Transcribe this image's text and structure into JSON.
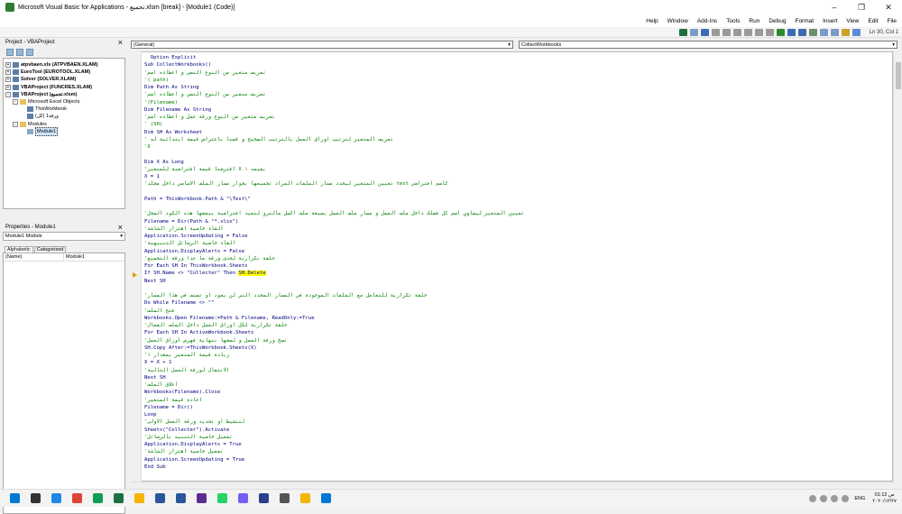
{
  "window": {
    "title": "Microsoft Visual Basic for Applications - تجميع.xlsm [break] - [Module1 (Code)]",
    "controls": [
      "–",
      "❐",
      "✕"
    ]
  },
  "menu": [
    "File",
    "Edit",
    "View",
    "Insert",
    "Format",
    "Debug",
    "Run",
    "Tools",
    "Add-Ins",
    "Window",
    "Help"
  ],
  "toolbar": {
    "position": "Ln 30, Col 1"
  },
  "project": {
    "title": "Project - VBAProject",
    "tree": [
      {
        "label": "atpvbaen.xls (ATPVBAEN.XLAM)",
        "bold": true,
        "toggle": "+",
        "indent": 0
      },
      {
        "label": "EuroTool (EUROTOOL.XLAM)",
        "bold": true,
        "toggle": "+",
        "indent": 0
      },
      {
        "label": "Solver (SOLVER.XLAM)",
        "bold": true,
        "toggle": "+",
        "indent": 0
      },
      {
        "label": "VBAProject (FUNCRES.XLAM)",
        "bold": true,
        "toggle": "+",
        "indent": 0
      },
      {
        "label": "VBAProject (تجميع.xlsm)",
        "bold": true,
        "toggle": "-",
        "indent": 0
      },
      {
        "label": "Microsoft Excel Objects",
        "bold": false,
        "toggle": "-",
        "indent": 1,
        "icon": "folder"
      },
      {
        "label": "ThisWorkbook",
        "bold": false,
        "toggle": "",
        "indent": 2,
        "icon": "sheet"
      },
      {
        "label": "(كل) ورقة1",
        "bold": false,
        "toggle": "",
        "indent": 2,
        "icon": "sheet"
      },
      {
        "label": "Modules",
        "bold": false,
        "toggle": "-",
        "indent": 1,
        "icon": "folder"
      },
      {
        "label": "Module1",
        "bold": false,
        "toggle": "",
        "indent": 2,
        "icon": "module",
        "selected": true
      }
    ]
  },
  "properties": {
    "title": "Properties - Module1",
    "object": "Module1 Module",
    "tabs": [
      "Alphabetic",
      "Categorized"
    ],
    "rows": [
      {
        "name": "(Name)",
        "value": "Module1"
      }
    ]
  },
  "code": {
    "object_combo": "(General)",
    "proc_combo": "CollectWorkbooks",
    "lines": [
      {
        "t": "  Option Explicit",
        "c": false
      },
      {
        "t": "Sub CollectWorkbooks()",
        "c": false
      },
      {
        "t": "تعريف متغير من النوع النصي و اعطاءه اسم'",
        "c": true,
        "ar": true
      },
      {
        "t": "'( path)",
        "c": true
      },
      {
        "t": "Dim Path As String",
        "c": false
      },
      {
        "t": "تعريف متغير من النوع النصي و اعطاءه اسم'",
        "c": true,
        "ar": true
      },
      {
        "t": "'(Filename)",
        "c": true
      },
      {
        "t": "Dim Filename As String",
        "c": false
      },
      {
        "t": "تعريف متغير من النوع ورقة عمل و اعطاءه اسم'",
        "c": true,
        "ar": true
      },
      {
        "t": "' (SH)",
        "c": true
      },
      {
        "t": "Dim SH As Worksheet",
        "c": false
      },
      {
        "t": "تعريف المتغير لترتيب اوراق العمل بالترتيب الصحيح و قمنا باعتراض قيمة ابتدائية له '",
        "c": true,
        "ar": true
      },
      {
        "t": "'X",
        "c": true
      },
      {
        "t": "",
        "c": false
      },
      {
        "t": "Dim X As Long",
        "c": false
      },
      {
        "t": "بقيمه ١ X افترضنا قيمة افتراضية للمتغير'",
        "c": true,
        "ar": true
      },
      {
        "t": "X = 1",
        "c": false
      },
      {
        "t": "كاسم افتراضي test تعيين المتغير ليحدد مسار الملفات المراد تجميعها بجوار مسار الملف الاساسي داخل مجلد'",
        "c": true,
        "ar": true
      },
      {
        "t": "",
        "c": false
      },
      {
        "t": "Path = ThisWorkbook.Path & \"\\Test\\\"",
        "c": false
      },
      {
        "t": "",
        "c": false
      },
      {
        "t": "تعيين المتغير ليساوي اسم كل فصلك داخل ملف العمل و مسار ملف العمل بصيغة ملف اكسل مالترو لتعيد افتراضية ببعضها هذه الكود المحل'",
        "c": true,
        "ar": true
      },
      {
        "t": "Filename = Dir(Path & \"*.xlsx\")",
        "c": false
      },
      {
        "t": "القاء خاصية اهتزاز الشاشة'",
        "c": true,
        "ar": true
      },
      {
        "t": "Application.ScreenUpdating = False",
        "c": false
      },
      {
        "t": "القاء خاصية الرسائل التنبيهية'",
        "c": true,
        "ar": true
      },
      {
        "t": "Application.DisplayAlerts = False",
        "c": false
      },
      {
        "t": "حلقة تكرارية لحذف ورقة ما عدا ورقة التجميع'",
        "c": true,
        "ar": true
      },
      {
        "t": "For Each SH In ThisWorkbook.Sheets",
        "c": false
      },
      {
        "t": "If SH.Name <> \"Collecter\" Then ",
        "c": false,
        "hl": "SH.Delete"
      },
      {
        "t": "Next SH",
        "c": false
      },
      {
        "t": "",
        "c": false
      },
      {
        "t": "حلقة تكرارية للتعامل مع الملفات الموجودة في المسار المحدد التي لن يعود او تصنف في هذا المسار'",
        "c": true,
        "ar": true
      },
      {
        "t": "Do While Filename <> \"\"",
        "c": false
      },
      {
        "t": "فتح الملف'",
        "c": true,
        "ar": true
      },
      {
        "t": "Workbooks.Open Filename:=Path & Filename, ReadOnly:=True",
        "c": false
      },
      {
        "t": "حلقة تكرارية لكل اوراق العمل داخل الملف الفعال'",
        "c": true,
        "ar": true
      },
      {
        "t": "For Each SH In ActiveWorkbook.Sheets",
        "c": false
      },
      {
        "t": "نسخ ورقة العمل و لصقها بنهاية فهرس اوراق العمل'",
        "c": true,
        "ar": true
      },
      {
        "t": "SH.Copy After:=ThisWorkbook.Sheets(X)",
        "c": false
      },
      {
        "t": "زيادة قيمة المتغير بمقدار ١'",
        "c": true,
        "ar": true
      },
      {
        "t": "X = X + 1",
        "c": false
      },
      {
        "t": "الانتقال لورقة العمل التالية'",
        "c": true,
        "ar": true
      },
      {
        "t": "Next SH",
        "c": false
      },
      {
        "t": "اغلاق الملف'",
        "c": true,
        "ar": true
      },
      {
        "t": "Workbooks(Filename).Close",
        "c": false
      },
      {
        "t": "اعادة قيمة المتغير'",
        "c": true,
        "ar": true
      },
      {
        "t": "Filename = Dir()",
        "c": false
      },
      {
        "t": "Loop",
        "c": false
      },
      {
        "t": "لتنشيط او تحديد ورقة العمل الاولى'",
        "c": true,
        "ar": true
      },
      {
        "t": "Sheets(\"Collecter\").Activate",
        "c": false
      },
      {
        "t": "تفعيل خاصية التنبيه بالرسائل'",
        "c": true,
        "ar": true
      },
      {
        "t": "Application.DisplayAlerts = True",
        "c": false
      },
      {
        "t": "تفعيل خاصية اهتزاز الشاشة'",
        "c": true,
        "ar": true
      },
      {
        "t": "Application.ScreenUpdating = True",
        "c": false
      },
      {
        "t": "End Sub",
        "c": false
      }
    ]
  },
  "taskbar": {
    "language": "ENG",
    "time": "01:12 ص",
    "date": "٢٠٢٠/١٢/٢٧",
    "apps": [
      {
        "icon": "windows-icon",
        "color": "#0078d4"
      },
      {
        "icon": "search-icon",
        "color": "#333333"
      },
      {
        "icon": "edge-icon",
        "color": "#1e88e5"
      },
      {
        "icon": "chrome-icon",
        "color": "#db4437"
      },
      {
        "icon": "edge-new-icon",
        "color": "#0f9d58"
      },
      {
        "icon": "excel-icon",
        "color": "#1d6f42"
      },
      {
        "icon": "chrome-2-icon",
        "color": "#f4b400"
      },
      {
        "icon": "folder-icon",
        "color": "#2b579a"
      },
      {
        "icon": "word-icon",
        "color": "#2b579a"
      },
      {
        "icon": "teams-icon",
        "color": "#5c2d91"
      },
      {
        "icon": "whatsapp-icon",
        "color": "#25d366"
      },
      {
        "icon": "viber-icon",
        "color": "#7360f2"
      },
      {
        "icon": "premiere-icon",
        "color": "#2c3e8f"
      },
      {
        "icon": "app-icon",
        "color": "#555555"
      },
      {
        "icon": "explorer-icon",
        "color": "#f2b600"
      },
      {
        "icon": "photos-icon",
        "color": "#0078d4"
      }
    ]
  }
}
